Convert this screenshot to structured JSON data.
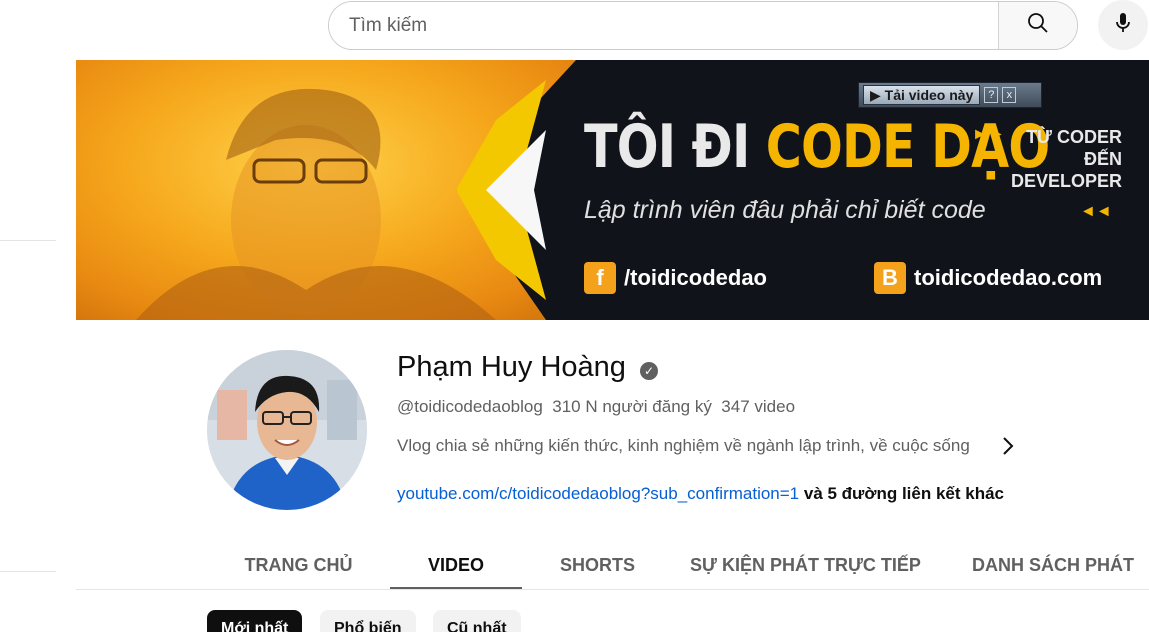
{
  "search": {
    "placeholder": "Tìm kiếm"
  },
  "icons": {
    "search": "search-icon",
    "mic": "mic-icon",
    "verified": "verified-check-icon",
    "chevron": "chevron-right-icon"
  },
  "banner": {
    "download_bar": {
      "label": "▶ Tải video này",
      "help": "?",
      "close": "x"
    },
    "title_white": "TÔI ĐI ",
    "title_yellow": "CODE DẠO",
    "arrows_right": "►►",
    "sub_line1": "TỪ CODER",
    "sub_line2": "ĐẾN DEVELOPER",
    "tagline": "Lập trình viên đâu phải chỉ biết code",
    "arrows_left": "◄◄",
    "facebook_badge": "f",
    "facebook": "/toidicodedao",
    "blogger_badge": "B",
    "website": "toidicodedao.com",
    "colors": {
      "accent": "#f4b400",
      "dark": "#10131a",
      "photo": "#f6a81c"
    }
  },
  "channel": {
    "name": "Phạm Huy Hoàng",
    "handle": "@toidicodedaoblog",
    "subscribers": "310 N người đăng ký",
    "videos": "347 video",
    "description": "Vlog chia sẻ những kiến thức, kinh nghiệm về ngành lập trình, về cuộc sống",
    "link": "youtube.com/c/toidicodedaoblog?sub_confirmation=1",
    "more_links": " và 5 đường liên kết khác"
  },
  "tabs": [
    {
      "label": "TRANG CHỦ"
    },
    {
      "label": "VIDEO"
    },
    {
      "label": "SHORTS"
    },
    {
      "label": "SỰ KIỆN PHÁT TRỰC TIẾP"
    },
    {
      "label": "DANH SÁCH PHÁT"
    }
  ],
  "chips": [
    {
      "label": "Mới nhất"
    },
    {
      "label": "Phổ biến"
    },
    {
      "label": "Cũ nhất"
    }
  ]
}
